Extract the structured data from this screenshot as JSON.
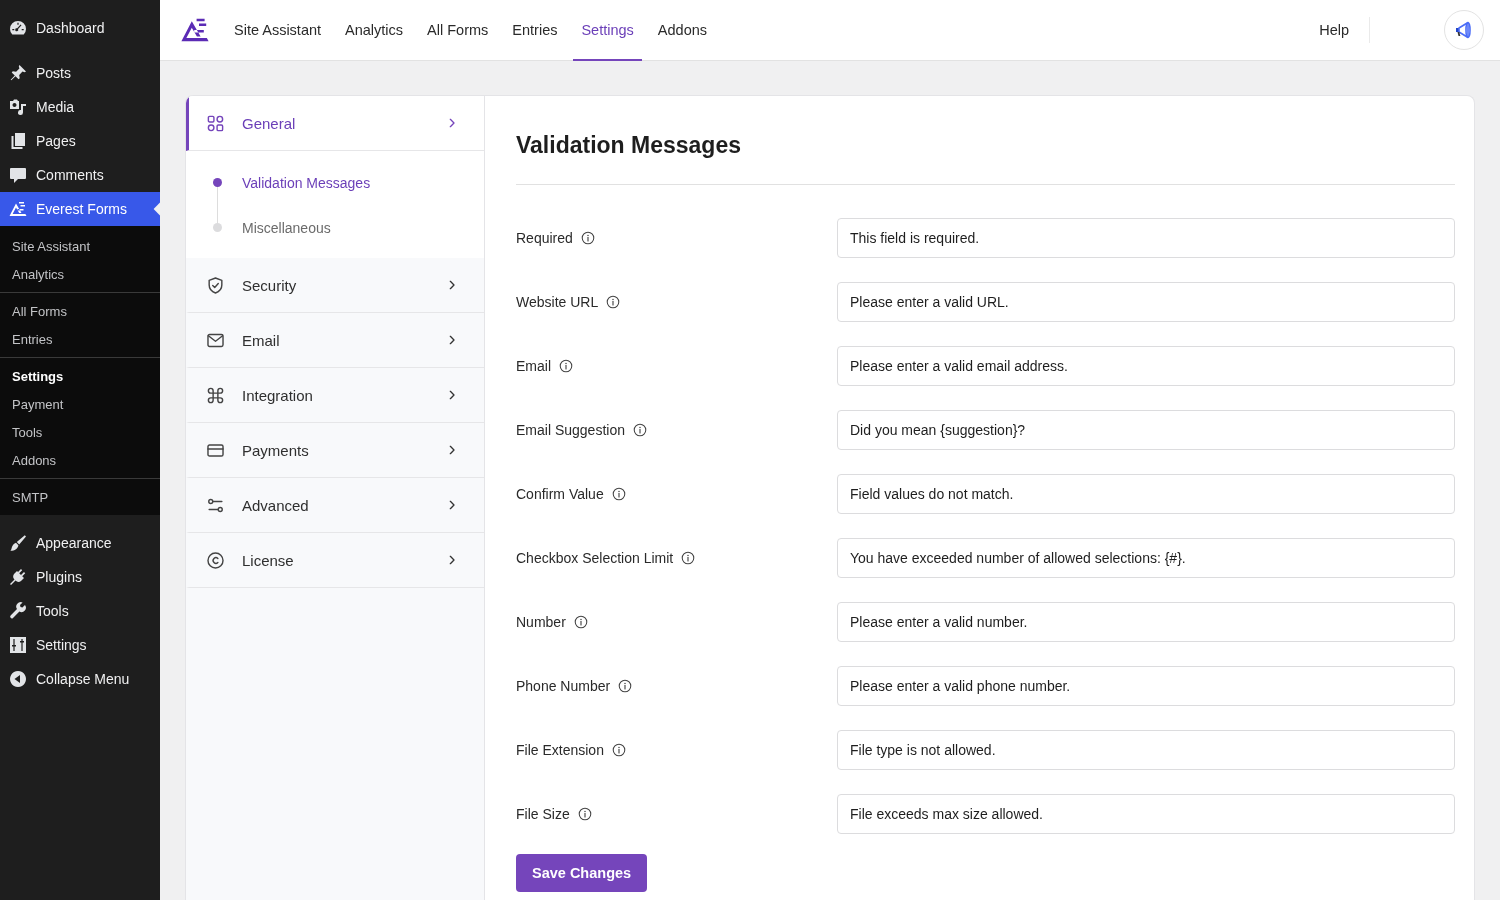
{
  "admin_menu": {
    "groups": [
      {
        "items": [
          {
            "label": "Dashboard",
            "selected": false
          }
        ]
      },
      {
        "items": [
          {
            "label": "Posts",
            "selected": false
          },
          {
            "label": "Media",
            "selected": false
          },
          {
            "label": "Pages",
            "selected": false
          },
          {
            "label": "Comments",
            "selected": false
          },
          {
            "label": "Everest Forms",
            "selected": true,
            "submenu": [
              {
                "items": [
                  {
                    "label": "Site Assistant",
                    "selected": false
                  },
                  {
                    "label": "Analytics",
                    "selected": false
                  }
                ]
              },
              {
                "items": [
                  {
                    "label": "All Forms",
                    "selected": false
                  },
                  {
                    "label": "Entries",
                    "selected": false
                  }
                ]
              },
              {
                "items": [
                  {
                    "label": "Settings",
                    "selected": true
                  },
                  {
                    "label": "Payment",
                    "selected": false
                  },
                  {
                    "label": "Tools",
                    "selected": false
                  },
                  {
                    "label": "Addons",
                    "selected": false
                  }
                ]
              },
              {
                "items": [
                  {
                    "label": "SMTP",
                    "selected": false
                  }
                ]
              }
            ]
          }
        ]
      },
      {
        "items": [
          {
            "label": "Appearance",
            "selected": false
          },
          {
            "label": "Plugins",
            "selected": false
          },
          {
            "label": "Tools",
            "selected": false
          },
          {
            "label": "Settings",
            "selected": false
          },
          {
            "label": "Collapse Menu",
            "selected": false
          }
        ]
      }
    ]
  },
  "top_nav": {
    "tabs": [
      {
        "label": "Site Assistant",
        "selected": false
      },
      {
        "label": "Analytics",
        "selected": false
      },
      {
        "label": "All Forms",
        "selected": false
      },
      {
        "label": "Entries",
        "selected": false
      },
      {
        "label": "Settings",
        "selected": true
      },
      {
        "label": "Addons",
        "selected": false
      }
    ],
    "help_link": "Help"
  },
  "settings_nav": {
    "items": [
      {
        "label": "General",
        "selected": true,
        "children": [
          {
            "label": "Validation Messages",
            "selected": true
          },
          {
            "label": "Miscellaneous",
            "selected": false
          }
        ]
      },
      {
        "label": "Security",
        "selected": false
      },
      {
        "label": "Email",
        "selected": false
      },
      {
        "label": "Integration",
        "selected": false
      },
      {
        "label": "Payments",
        "selected": false
      },
      {
        "label": "Advanced",
        "selected": false
      },
      {
        "label": "License",
        "selected": false
      }
    ]
  },
  "panel": {
    "title": "Validation Messages",
    "fields": [
      {
        "label": "Required",
        "value": "This field is required."
      },
      {
        "label": "Website URL",
        "value": "Please enter a valid URL."
      },
      {
        "label": "Email",
        "value": "Please enter a valid email address."
      },
      {
        "label": "Email Suggestion",
        "value": "Did you mean {suggestion}?"
      },
      {
        "label": "Confirm Value",
        "value": "Field values do not match."
      },
      {
        "label": "Checkbox Selection Limit",
        "value": "You have exceeded number of allowed selections: {#}."
      },
      {
        "label": "Number",
        "value": "Please enter a valid number."
      },
      {
        "label": "Phone Number",
        "value": "Please enter a valid phone number."
      },
      {
        "label": "File Extension",
        "value": "File type is not allowed."
      },
      {
        "label": "File Size",
        "value": "File exceeds max size allowed."
      }
    ],
    "save_button": "Save Changes"
  }
}
